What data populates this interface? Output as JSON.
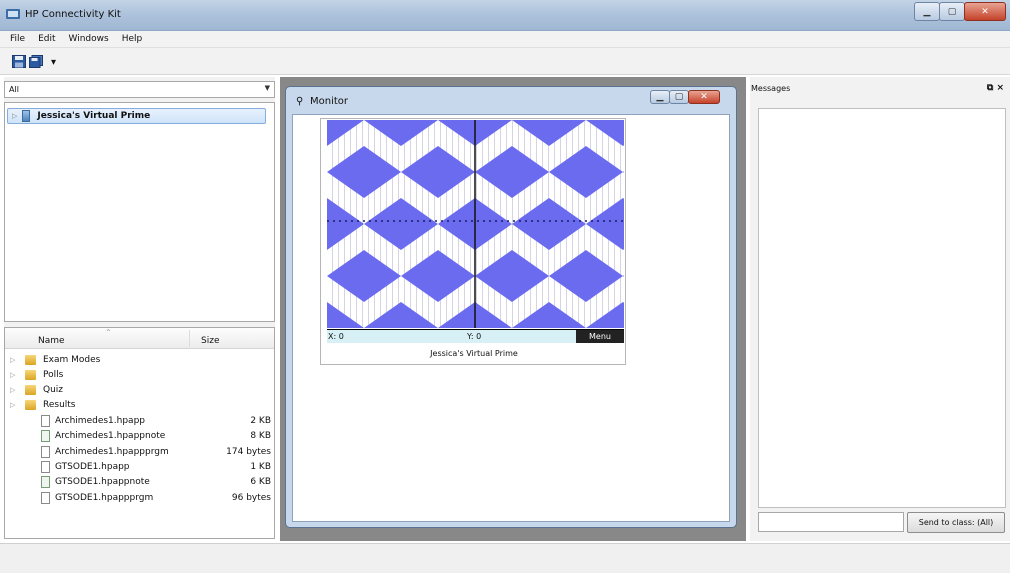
{
  "window": {
    "title": "HP Connectivity Kit"
  },
  "menu": [
    "File",
    "Edit",
    "Windows",
    "Help"
  ],
  "toolbar": {
    "save_icon": "save-icon",
    "save_all_icon": "save-all-icon"
  },
  "left": {
    "filter_value": "All",
    "device_name": "Jessica's Virtual Prime",
    "columns": {
      "name": "Name",
      "size": "Size"
    },
    "folders": [
      "Exam Modes",
      "Polls",
      "Quiz",
      "Results"
    ],
    "files": [
      {
        "name": "Archimedes1.hpapp",
        "size": "2 KB",
        "icon": "file-icon"
      },
      {
        "name": "Archimedes1.hpappnote",
        "size": "8 KB",
        "icon": "note-file-icon"
      },
      {
        "name": "Archimedes1.hpappprgm",
        "size": "174 bytes",
        "icon": "file-icon"
      },
      {
        "name": "GTSODE1.hpapp",
        "size": "1 KB",
        "icon": "file-icon"
      },
      {
        "name": "GTSODE1.hpappnote",
        "size": "6 KB",
        "icon": "note-file-icon"
      },
      {
        "name": "GTSODE1.hpappprgm",
        "size": "96 bytes",
        "icon": "file-icon"
      }
    ]
  },
  "monitor": {
    "title": "Monitor",
    "x_readout": "X: 0",
    "y_readout": "Y: 0",
    "menu_label": "Menu",
    "device_label": "Jessica's Virtual Prime",
    "pattern_color": "#6b6bf0"
  },
  "messages": {
    "title": "Messages",
    "input_value": "",
    "send_label": "Send to class: (All)"
  }
}
